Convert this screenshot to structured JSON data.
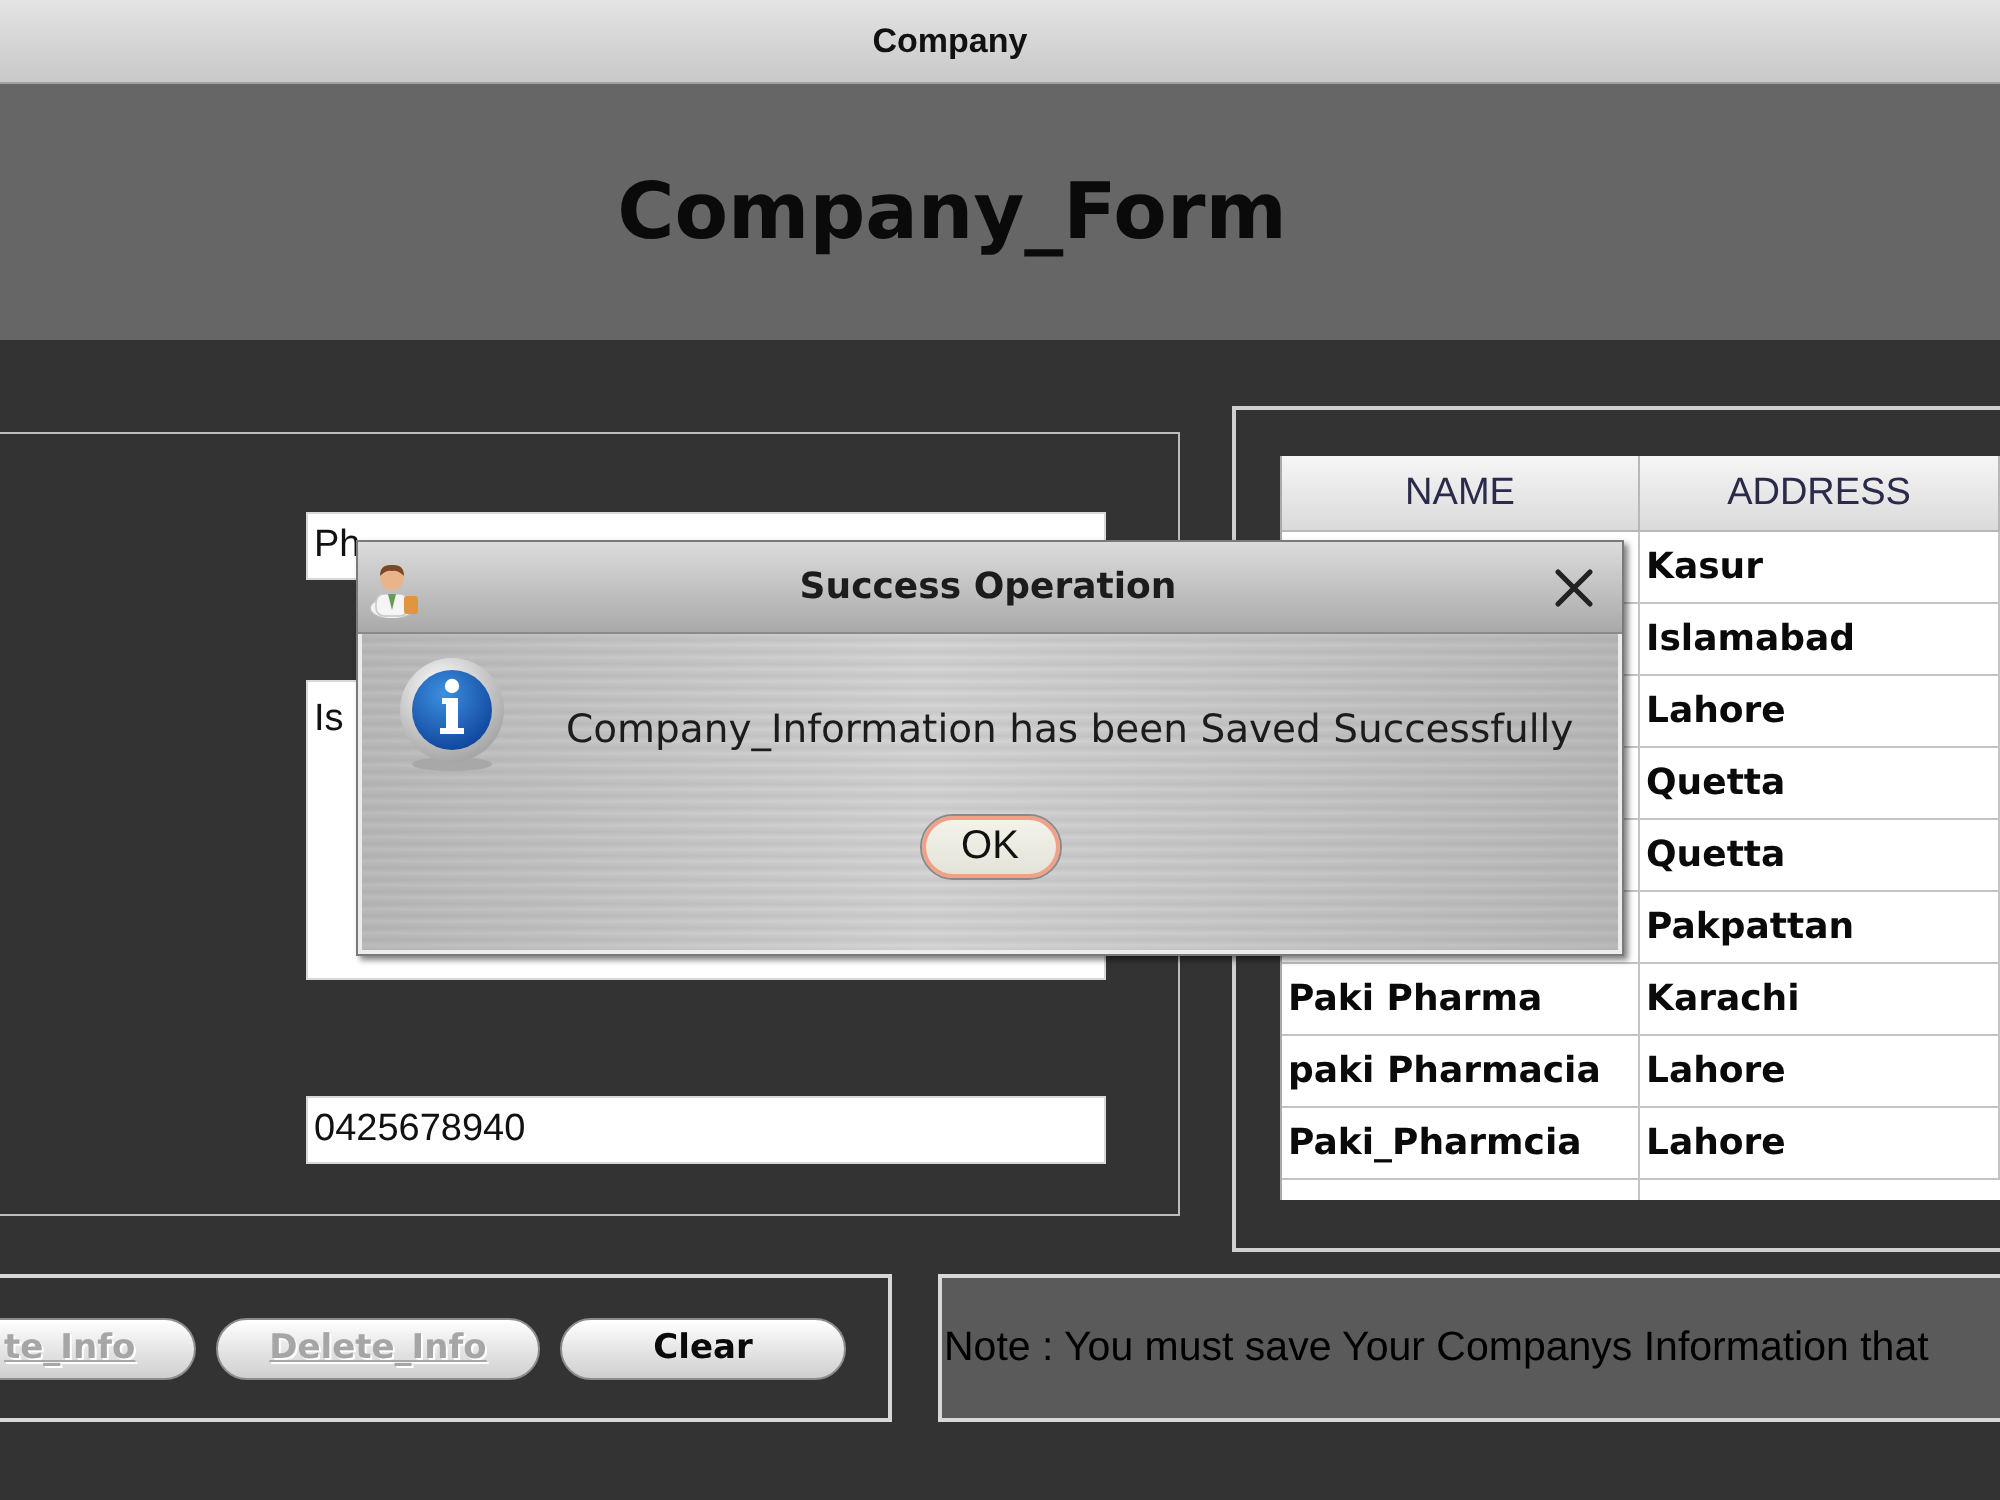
{
  "window": {
    "title": "Company"
  },
  "header": {
    "title": "Company_Form"
  },
  "form": {
    "fields": [
      {
        "kind": "text",
        "value": "Ph"
      },
      {
        "kind": "textarea",
        "value": "Is"
      },
      {
        "kind": "text",
        "value": "0425678940"
      }
    ]
  },
  "table": {
    "columns": [
      "NAME",
      "ADDRESS"
    ],
    "rows": [
      {
        "address": "Kasur"
      },
      {
        "address": "Islamabad"
      },
      {
        "address": "Lahore"
      },
      {
        "address": "Quetta"
      },
      {
        "address": "Quetta"
      },
      {
        "address": "Pakpattan"
      },
      {
        "name": "Paki Pharma",
        "address": "Karachi"
      },
      {
        "name": "paki Pharmacia",
        "address": "Lahore"
      },
      {
        "name": "Paki_Pharmcia",
        "address": "Lahore"
      }
    ]
  },
  "buttons": [
    {
      "label": "te_Info",
      "disabled": true
    },
    {
      "label": "Delete_Info",
      "disabled": true
    },
    {
      "label": "Clear",
      "disabled": false
    }
  ],
  "note": "Note : You must save Your Companys Information that",
  "dialog": {
    "title": "Success Operation",
    "message": "Company_Information has been Saved Successfully",
    "buttons": [
      {
        "label": "OK",
        "focused": true
      }
    ]
  }
}
